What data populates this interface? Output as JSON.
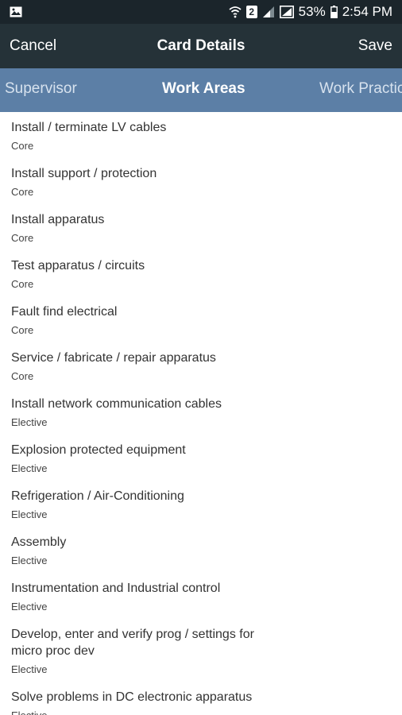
{
  "status_bar": {
    "badge": "2",
    "battery": "53%",
    "time": "2:54 PM"
  },
  "app_bar": {
    "cancel_label": "Cancel",
    "title": "Card Details",
    "save_label": "Save"
  },
  "tabs": [
    {
      "label": "Supervisor"
    },
    {
      "label": "Work Areas"
    },
    {
      "label": "Work Practices"
    }
  ],
  "work_areas": [
    {
      "title": "Install / terminate LV cables",
      "category": "Core"
    },
    {
      "title": "Install support / protection",
      "category": "Core"
    },
    {
      "title": "Install apparatus",
      "category": "Core"
    },
    {
      "title": "Test apparatus / circuits",
      "category": "Core"
    },
    {
      "title": "Fault find electrical",
      "category": "Core"
    },
    {
      "title": "Service / fabricate / repair apparatus",
      "category": "Core"
    },
    {
      "title": "Install network communication cables",
      "category": "Elective"
    },
    {
      "title": "Explosion protected equipment",
      "category": "Elective"
    },
    {
      "title": "Refrigeration / Air-Conditioning",
      "category": "Elective"
    },
    {
      "title": "Assembly",
      "category": "Elective"
    },
    {
      "title": "Instrumentation and Industrial control",
      "category": "Elective"
    },
    {
      "title": "Develop, enter and verify prog / settings for micro proc dev",
      "category": "Elective"
    },
    {
      "title": "Solve problems in DC electronic apparatus",
      "category": "Elective"
    }
  ]
}
